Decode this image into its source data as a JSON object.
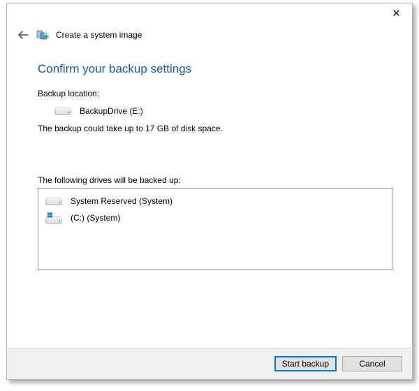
{
  "window": {
    "title": "Create a system image"
  },
  "page": {
    "title": "Confirm your backup settings",
    "backup_location_label": "Backup location:",
    "backup_location_value": "BackupDrive (E:)",
    "size_note": "The backup could take up to 17 GB of disk space.",
    "drives_label": "The following drives will be backed up:"
  },
  "drives": [
    {
      "name": "System Reserved (System)",
      "icon": "hdd"
    },
    {
      "name": "(C:) (System)",
      "icon": "windows-hdd"
    }
  ],
  "buttons": {
    "start": "Start backup",
    "cancel": "Cancel"
  }
}
